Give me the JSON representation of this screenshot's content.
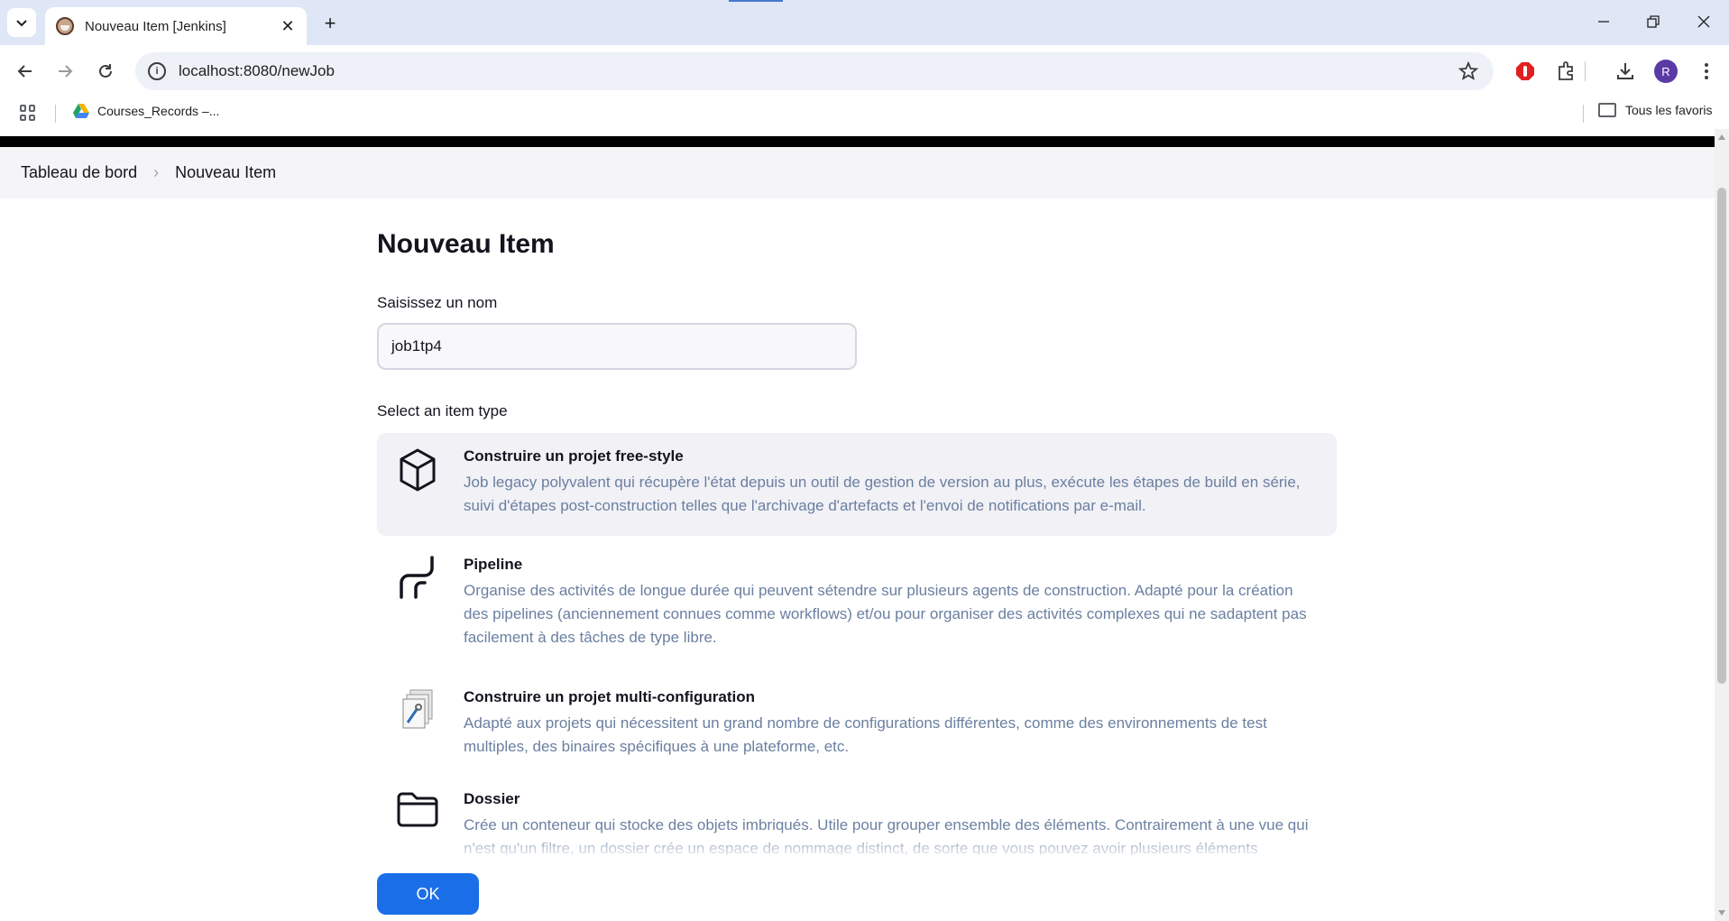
{
  "browser": {
    "tab_title": "Nouveau Item [Jenkins]",
    "url": "localhost:8080/newJob",
    "profile_initial": "R",
    "bookmarks": [
      {
        "label": "Courses_Records –..."
      }
    ],
    "bookmarks_folder": "Tous les favoris"
  },
  "breadcrumb": {
    "items": [
      "Tableau de bord",
      "Nouveau Item"
    ]
  },
  "page": {
    "title": "Nouveau Item",
    "name_label": "Saisissez un nom",
    "name_value": "job1tp4",
    "type_label": "Select an item type",
    "item_types": [
      {
        "title": "Construire un projet free-style",
        "description": "Job legacy polyvalent qui récupère l'état depuis un outil de gestion de version au plus, exécute les étapes de build en série, suivi d'étapes post-construction telles que l'archivage d'artefacts et l'envoi de notifications par e-mail.",
        "icon": "cube-icon",
        "selected": true
      },
      {
        "title": "Pipeline",
        "description": "Organise des activités de longue durée qui peuvent sétendre sur plusieurs agents de construction. Adapté pour la création des pipelines (anciennement connues comme workflows) et/ou pour organiser des activités complexes qui ne sadaptent pas facilement à des tâches de type libre.",
        "icon": "pipeline-icon",
        "selected": false
      },
      {
        "title": "Construire un projet multi-configuration",
        "description": "Adapté aux projets qui nécessitent un grand nombre de configurations différentes, comme des environnements de test multiples, des binaires spécifiques à une plateforme, etc.",
        "icon": "multi-config-icon",
        "selected": false
      },
      {
        "title": "Dossier",
        "description": "Crée un conteneur qui stocke des objets imbriqués. Utile pour grouper ensemble des éléments. Contrairement à une vue qui n'est qu'un filtre, un dossier crée un espace de nommage distinct, de sorte que vous pouvez avoir plusieurs éléments",
        "icon": "folder-icon",
        "selected": false
      }
    ],
    "ok_label": "OK"
  },
  "colors": {
    "accent": "#1a6fe8",
    "description_text": "#6a7fa0",
    "selected_bg": "#f1f1f6"
  }
}
